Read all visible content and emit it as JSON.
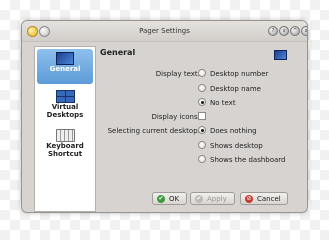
{
  "window": {
    "title": "Pager Settings"
  },
  "titlebar": {
    "help": "?",
    "minimize": "v",
    "maximize": "^",
    "close": "x"
  },
  "sidebar": {
    "items": [
      {
        "label": "General",
        "selected": true
      },
      {
        "label": "Virtual Desktops",
        "selected": false
      },
      {
        "label": "Keyboard Shortcut",
        "selected": false
      }
    ]
  },
  "general": {
    "title": "General",
    "display_text": {
      "label": "Display text:",
      "options": [
        "Desktop number",
        "Desktop name",
        "No text"
      ],
      "selected": "No text"
    },
    "display_icons": {
      "label": "Display icons:",
      "checked": false
    },
    "selecting_current_desktop": {
      "label": "Selecting current desktop:",
      "options": [
        "Does nothing",
        "Shows desktop",
        "Shows the dashboard"
      ],
      "selected": "Does nothing"
    }
  },
  "buttons": {
    "ok": "OK",
    "apply": "Apply",
    "cancel": "Cancel"
  },
  "colors": {
    "selection": "#5b9bd8",
    "window_bg": "#d6d3d0",
    "ok_icon": "#3c9b3c",
    "cancel_icon": "#c43a2e"
  }
}
